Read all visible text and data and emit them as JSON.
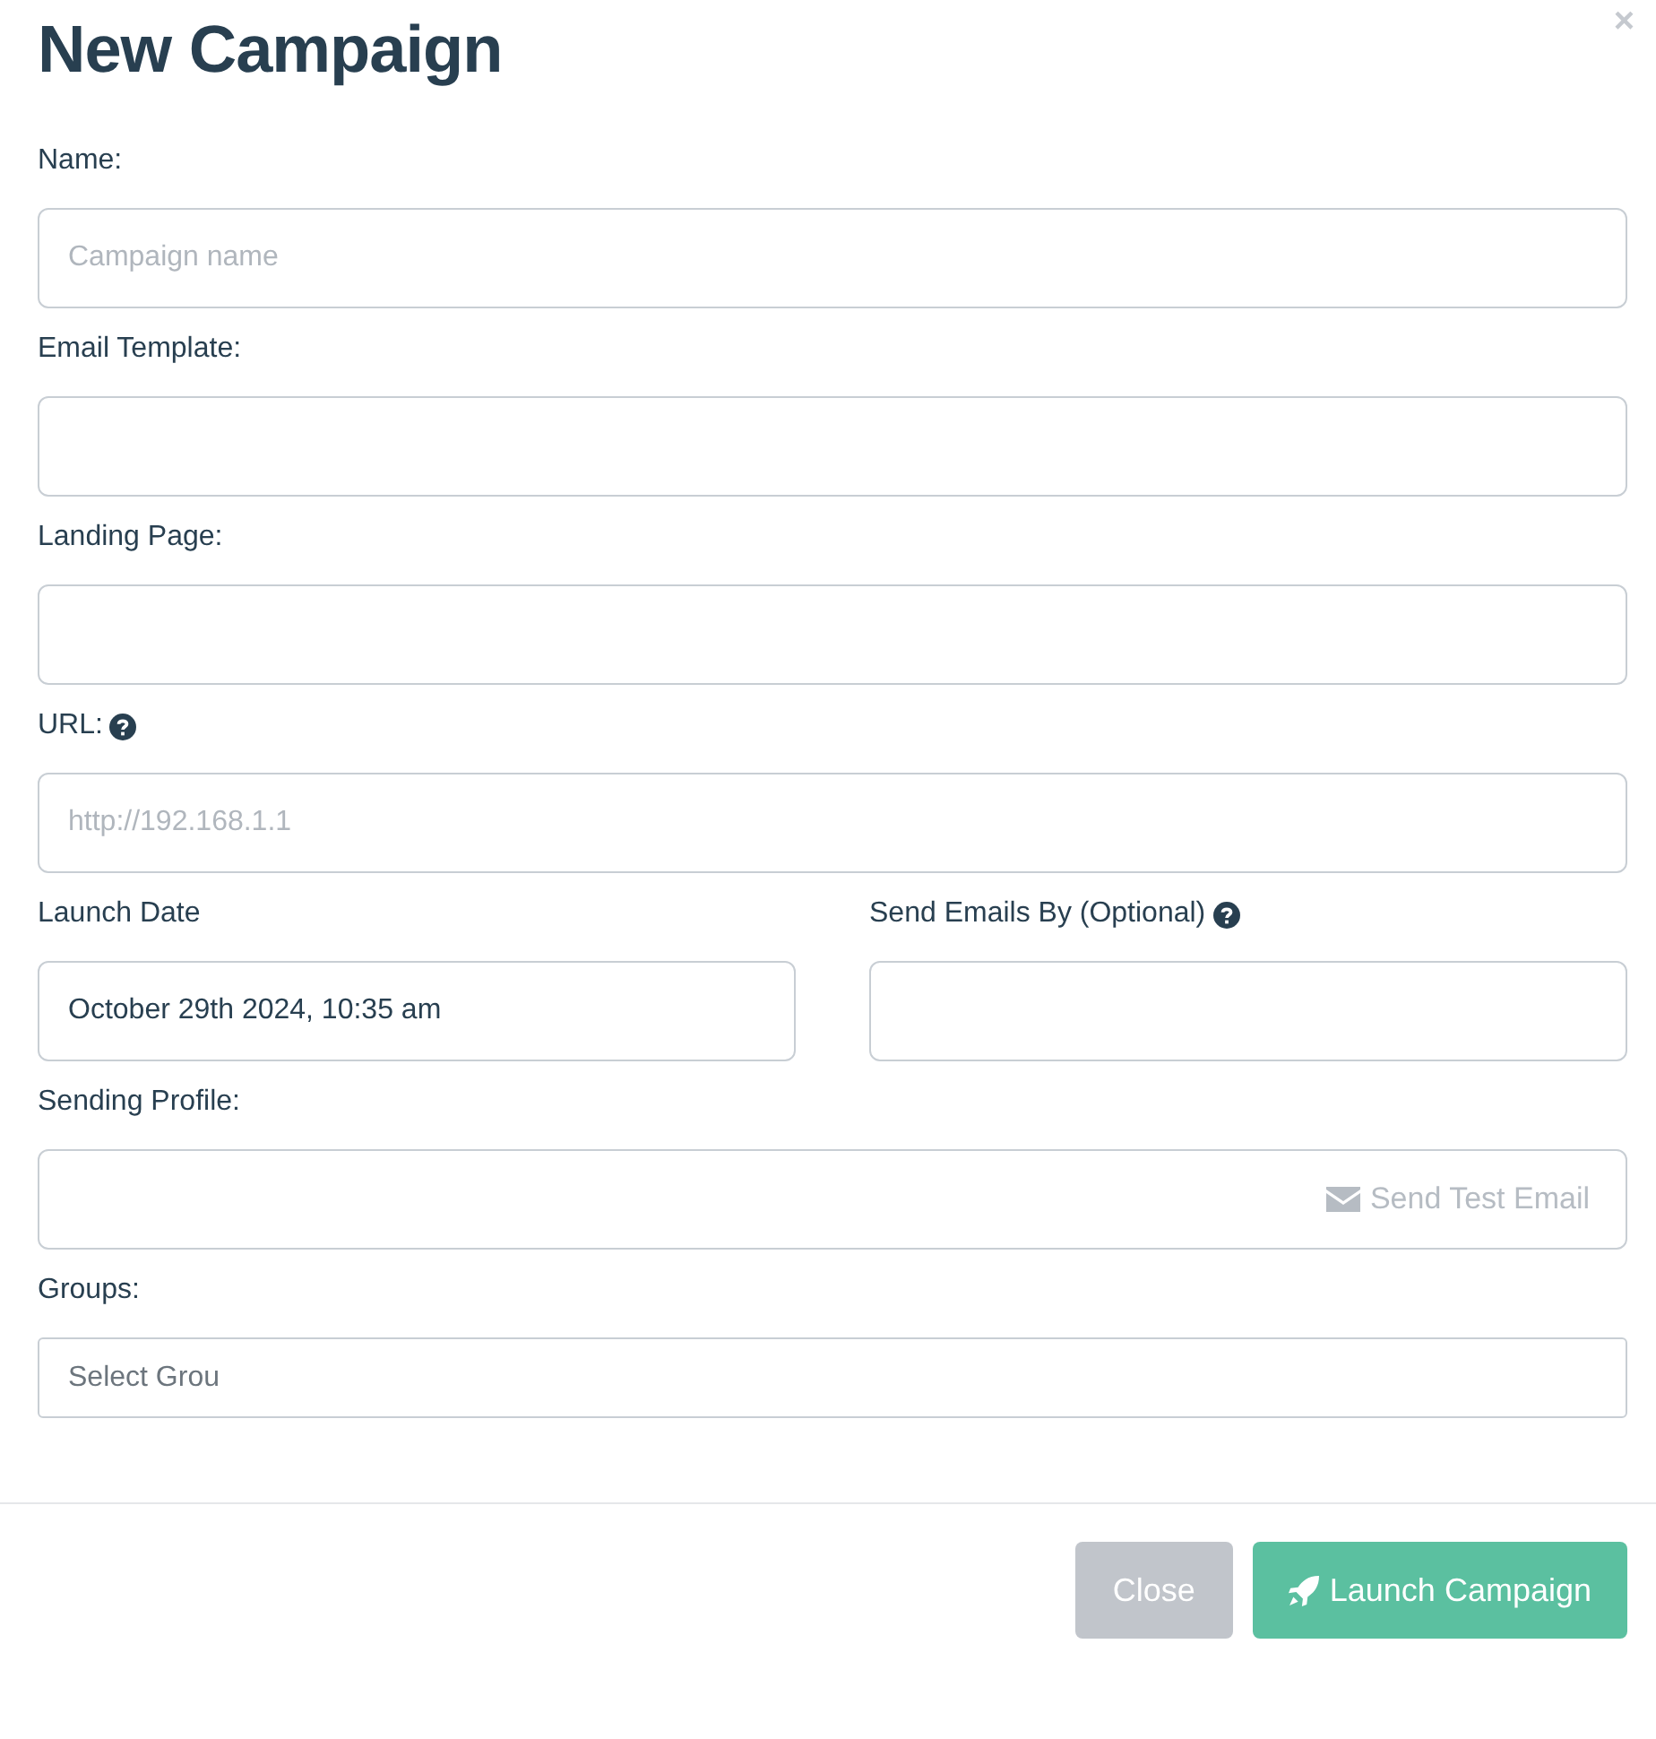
{
  "title": "New Campaign",
  "close": "×",
  "rows": [
    [
      {
        "label": "Name:",
        "help": false,
        "placeholder": "Campaign name",
        "kind": "text"
      }
    ],
    [
      {
        "label": "Email Template:",
        "help": false,
        "kind": "text"
      }
    ],
    [
      {
        "label": "Landing Page:",
        "help": false,
        "kind": "text"
      }
    ],
    [
      {
        "label": "URL:",
        "help": true,
        "placeholder": "http://192.168.1.1",
        "kind": "text"
      }
    ],
    [
      {
        "label": "Launch Date",
        "help": false,
        "value": "October 29th 2024, 10:35 am",
        "kind": "text"
      },
      {
        "label": "Send Emails By (Optional)",
        "help": true,
        "kind": "text"
      }
    ],
    [
      {
        "label": "Sending Profile:",
        "help": false,
        "kind": "profile",
        "button": "Send Test Email"
      }
    ],
    [
      {
        "label": "Groups:",
        "help": false,
        "placeholder": "Select Grou",
        "kind": "select"
      }
    ]
  ],
  "buttons": [
    {
      "label": "Close",
      "kind": "secondary"
    },
    {
      "label": "Launch Campaign",
      "kind": "primary"
    }
  ]
}
